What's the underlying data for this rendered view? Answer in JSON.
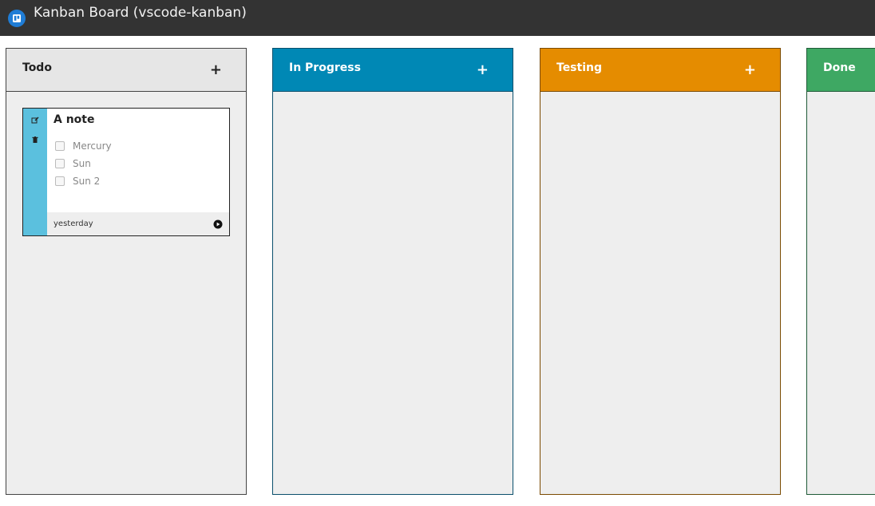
{
  "window": {
    "title": "Kanban Board (vscode-kanban)",
    "icon": "kanban-board-icon"
  },
  "columns": [
    {
      "title": "Todo",
      "add_label": "+",
      "header_color": "#e6e6e6",
      "header_text_color": "#222222",
      "border_color": "#444444"
    },
    {
      "title": "In Progress",
      "add_label": "+",
      "header_color": "#0088b5",
      "header_text_color": "#ffffff",
      "border_color": "#0a4f6c"
    },
    {
      "title": "Testing",
      "add_label": "+",
      "header_color": "#e58c00",
      "header_text_color": "#ffffff",
      "border_color": "#7a4a00"
    },
    {
      "title": "Done",
      "add_label": "+",
      "header_color": "#3ea863",
      "header_text_color": "#ffffff",
      "border_color": "#1f5a37"
    }
  ],
  "card": {
    "title": "A note",
    "items": [
      "Mercury",
      "Sun",
      "Sun 2"
    ],
    "time": "yesterday",
    "accent_color": "#5bc0de",
    "edit_icon": "edit-icon",
    "delete_icon": "trash-icon",
    "play_icon": "play-circle-icon"
  }
}
